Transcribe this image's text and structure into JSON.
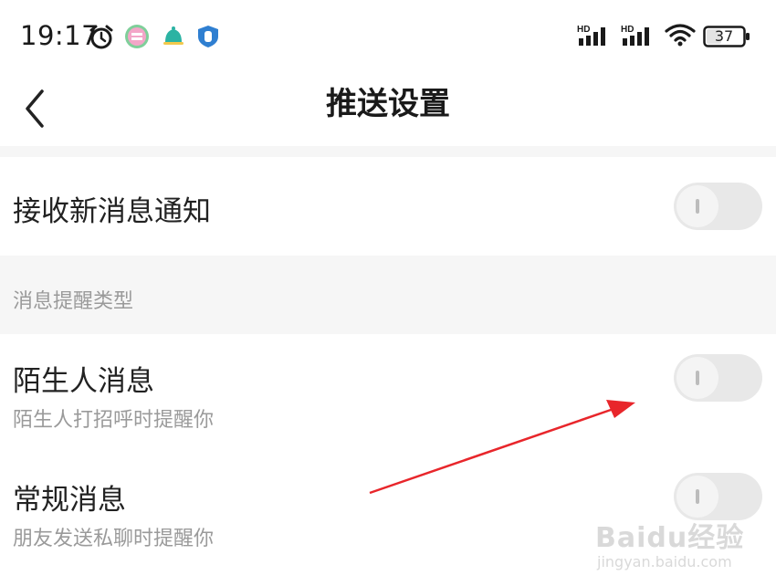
{
  "status_bar": {
    "time": "19:17",
    "battery": "37",
    "signal1_label": "HD",
    "signal2_label": "HD",
    "icons": [
      "alarm-clock-icon",
      "app-badge-icon",
      "bell-icon",
      "shield-icon",
      "signal-icon",
      "signal-icon",
      "wifi-icon",
      "battery-icon"
    ]
  },
  "header": {
    "title": "推送设置",
    "back_icon": "chevron-left-icon"
  },
  "receive_notifications": {
    "title": "接收新消息通知",
    "enabled": false
  },
  "section": {
    "label": "消息提醒类型"
  },
  "stranger_messages": {
    "title": "陌生人消息",
    "subtitle": "陌生人打招呼时提醒你",
    "enabled": false
  },
  "regular_messages": {
    "title": "常规消息",
    "subtitle": "朋友发送私聊时提醒你",
    "enabled": false
  },
  "watermark": {
    "main": "Baidu经验",
    "sub": "jingyan.baidu.com"
  },
  "colors": {
    "toggle_off_track": "#e8e8e8",
    "section_bg": "#f6f6f6",
    "annotation_arrow": "#e8262b"
  }
}
